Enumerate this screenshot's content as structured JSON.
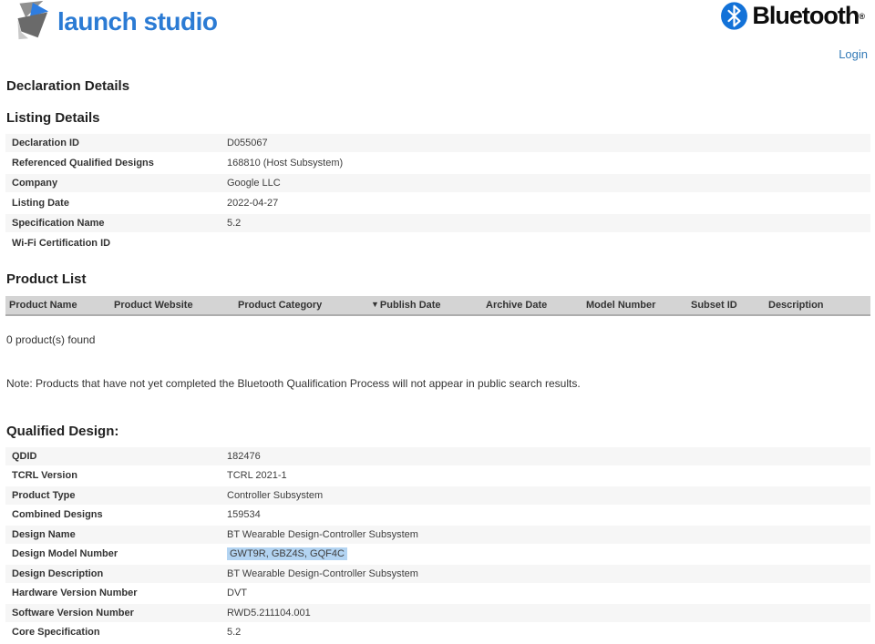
{
  "header": {
    "logo_text": "launch studio",
    "bluetooth_wordmark": "Bluetooth",
    "registered_mark": "®",
    "login_label": "Login"
  },
  "page_title": "Declaration Details",
  "listing_details": {
    "heading": "Listing Details",
    "rows": [
      {
        "label": "Declaration ID",
        "value": "D055067"
      },
      {
        "label": "Referenced Qualified Designs",
        "value": "168810 (Host Subsystem)"
      },
      {
        "label": "Company",
        "value": "Google LLC"
      },
      {
        "label": "Listing Date",
        "value": "2022-04-27"
      },
      {
        "label": "Specification Name",
        "value": "5.2"
      },
      {
        "label": "Wi-Fi Certification ID",
        "value": ""
      }
    ]
  },
  "product_list": {
    "heading": "Product List",
    "columns": [
      "Product Name",
      "Product Website",
      "Product Category",
      "Publish Date",
      "Archive Date",
      "Model Number",
      "Subset ID",
      "Description"
    ],
    "sort_indicator": "▼",
    "sorted_column": "Publish Date",
    "result_count_text": "0 product(s) found",
    "note": "Note: Products that have not yet completed the Bluetooth Qualification Process will not appear in public search results."
  },
  "qualified_design": {
    "heading": "Qualified Design:",
    "rows": [
      {
        "label": "QDID",
        "value": "182476"
      },
      {
        "label": "TCRL Version",
        "value": "TCRL 2021-1"
      },
      {
        "label": "Product Type",
        "value": "Controller Subsystem"
      },
      {
        "label": "Combined Designs",
        "value": "159534"
      },
      {
        "label": "Design Name",
        "value": "BT Wearable Design-Controller Subsystem"
      },
      {
        "label": "Design Model Number",
        "value": "GWT9R, GBZ4S, GQF4C",
        "highlighted": true
      },
      {
        "label": "Design Description",
        "value": "BT Wearable Design-Controller Subsystem"
      },
      {
        "label": "Hardware Version Number",
        "value": "DVT"
      },
      {
        "label": "Software Version Number",
        "value": "RWD5.211104.001"
      },
      {
        "label": "Core Specification",
        "value": "5.2"
      }
    ]
  },
  "colors": {
    "brand_blue": "#2b7bd4",
    "link_blue": "#337ab7",
    "bluetooth_blue": "#1372d8",
    "row_stripe": "#f6f6f6",
    "table_header_bg": "#d4d4d4",
    "selection_highlight": "#b3d4f2"
  }
}
